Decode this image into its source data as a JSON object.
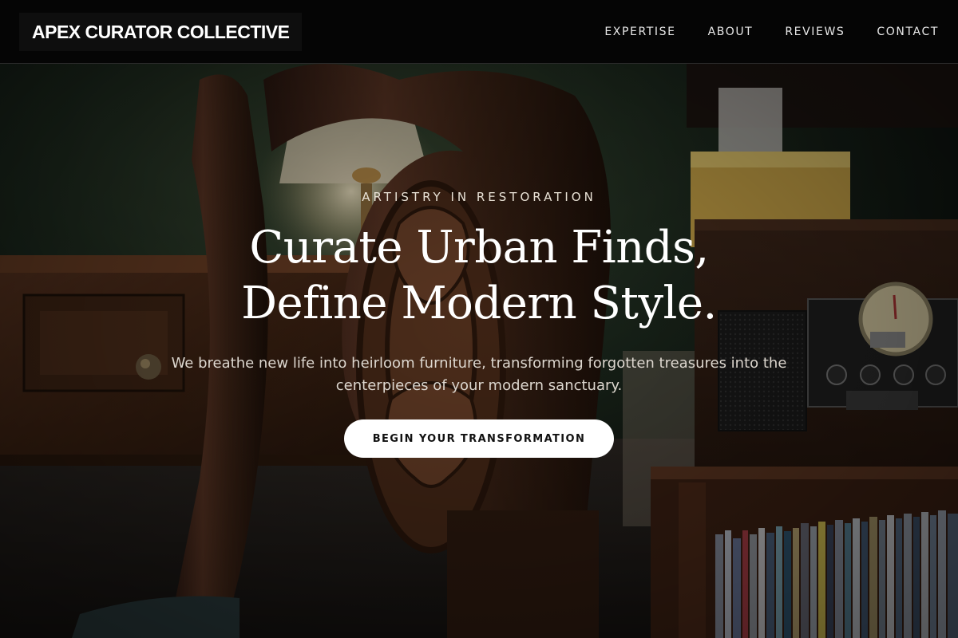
{
  "header": {
    "brand": "APEX CURATOR COLLECTIVE",
    "nav": [
      {
        "label": "EXPERTISE"
      },
      {
        "label": "ABOUT"
      },
      {
        "label": "REVIEWS"
      },
      {
        "label": "CONTACT"
      }
    ]
  },
  "hero": {
    "eyebrow": "ARTISTRY IN RESTORATION",
    "headline_line1": "Curate Urban Finds,",
    "headline_line2": "Define Modern Style.",
    "subtext": "We breathe new life into heirloom furniture, transforming forgotten treasures into the centerpieces of your modern sanctuary.",
    "cta_label": "BEGIN YOUR TRANSFORMATION",
    "background_image": "dark-wood-carved-chair-with-vintage-radio-and-record-shelf"
  },
  "colors": {
    "navbar_bg": "#050505",
    "text_primary": "#ffffff",
    "cta_bg": "#ffffff",
    "cta_text": "#111111",
    "wood": "#4a2a16",
    "wall_green": "#1d2a1e"
  }
}
